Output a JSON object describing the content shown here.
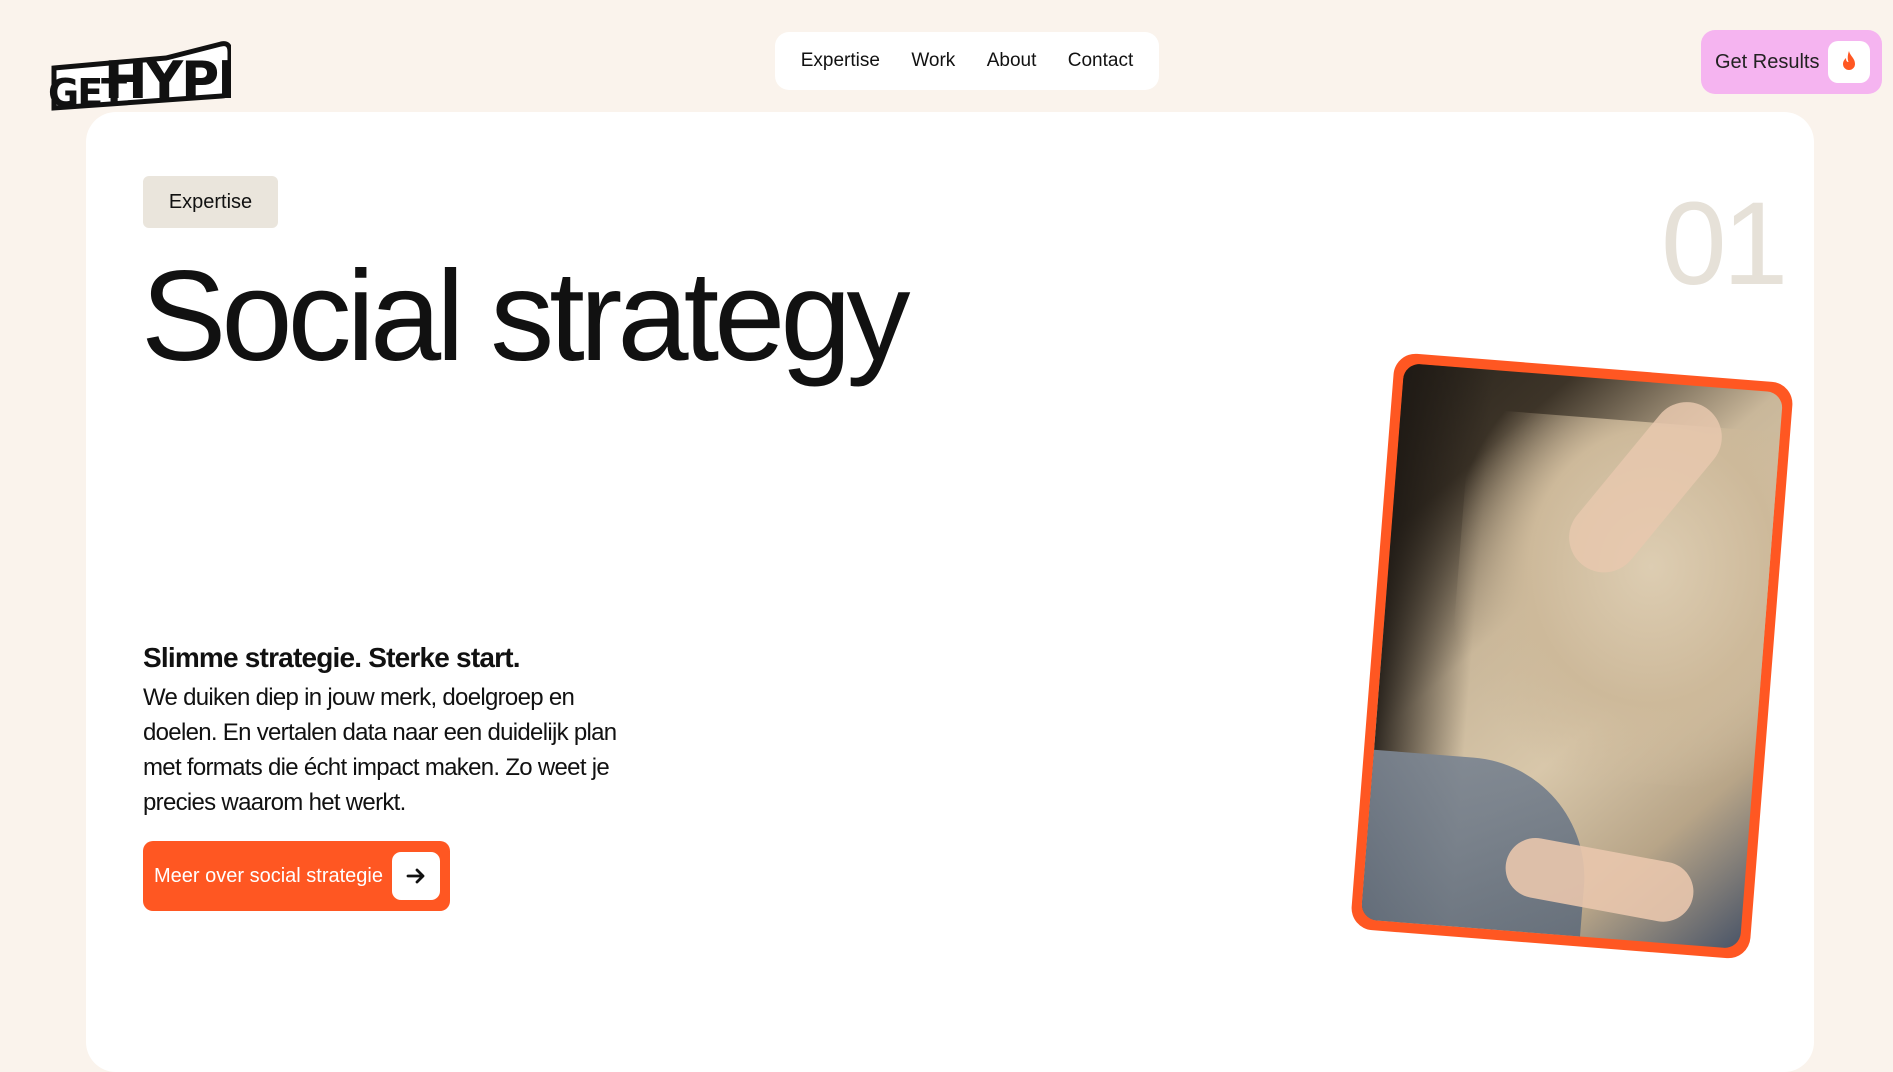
{
  "header": {
    "logo_alt": "GET HYPED",
    "logo_part1": "GET",
    "logo_part2": "HYPED",
    "nav": [
      {
        "label": "Expertise"
      },
      {
        "label": "Work"
      },
      {
        "label": "About"
      },
      {
        "label": "Contact"
      }
    ],
    "cta_label": "Get Results",
    "cta_icon": "flame-icon"
  },
  "hero": {
    "tag": "Expertise",
    "title": "Social strategy",
    "number": "01",
    "subhead": "Slimme strategie. Sterke start.",
    "body": "We duiken diep in jouw merk, doelgroep en doelen. En vertalen data naar een duidelijk plan met formats die écht impact maken. Zo weet je precies waarom het werkt.",
    "button_label": "Meer over social strategie",
    "button_icon": "arrow-right-icon",
    "image_icon": "person-photo"
  },
  "colors": {
    "background": "#faf3ec",
    "card": "#ffffff",
    "accent_orange": "#ff5722",
    "accent_pink": "#f5b4f0",
    "tag_bg": "#eae5dc",
    "number_color": "#e6e1d8"
  }
}
